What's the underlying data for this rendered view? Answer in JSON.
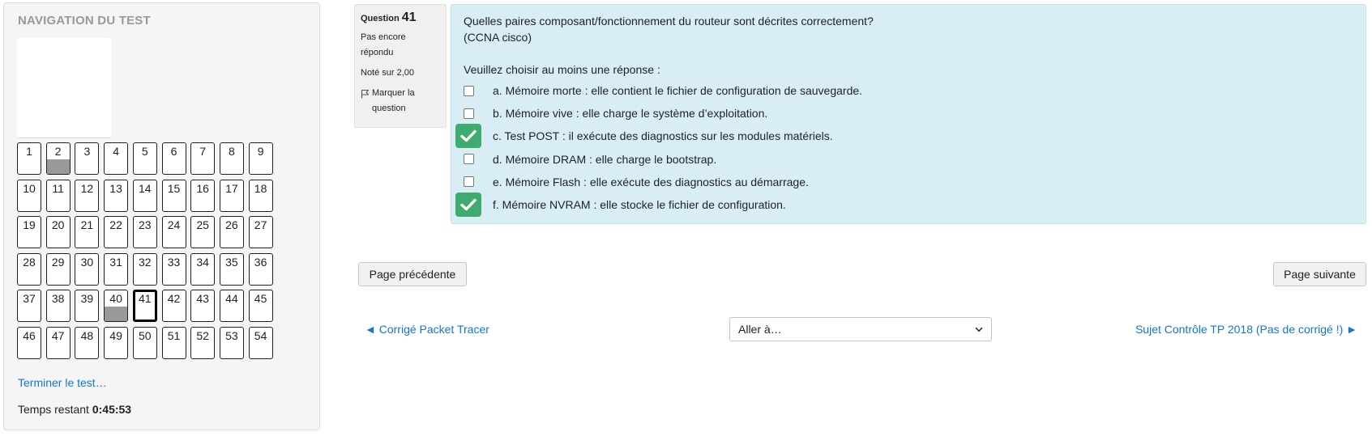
{
  "nav": {
    "title": "NAVIGATION DU TEST",
    "questions": [
      {
        "n": "1",
        "state": "unanswered"
      },
      {
        "n": "2",
        "state": "answered"
      },
      {
        "n": "3",
        "state": "unanswered"
      },
      {
        "n": "4",
        "state": "unanswered"
      },
      {
        "n": "5",
        "state": "unanswered"
      },
      {
        "n": "6",
        "state": "unanswered"
      },
      {
        "n": "7",
        "state": "unanswered"
      },
      {
        "n": "8",
        "state": "unanswered"
      },
      {
        "n": "9",
        "state": "unanswered"
      },
      {
        "n": "10",
        "state": "unanswered"
      },
      {
        "n": "11",
        "state": "unanswered"
      },
      {
        "n": "12",
        "state": "unanswered"
      },
      {
        "n": "13",
        "state": "unanswered"
      },
      {
        "n": "14",
        "state": "unanswered"
      },
      {
        "n": "15",
        "state": "unanswered"
      },
      {
        "n": "16",
        "state": "unanswered"
      },
      {
        "n": "17",
        "state": "unanswered"
      },
      {
        "n": "18",
        "state": "unanswered"
      },
      {
        "n": "19",
        "state": "unanswered"
      },
      {
        "n": "20",
        "state": "unanswered"
      },
      {
        "n": "21",
        "state": "unanswered"
      },
      {
        "n": "22",
        "state": "unanswered"
      },
      {
        "n": "23",
        "state": "unanswered"
      },
      {
        "n": "24",
        "state": "unanswered"
      },
      {
        "n": "25",
        "state": "unanswered"
      },
      {
        "n": "26",
        "state": "unanswered"
      },
      {
        "n": "27",
        "state": "unanswered"
      },
      {
        "n": "28",
        "state": "unanswered"
      },
      {
        "n": "29",
        "state": "unanswered"
      },
      {
        "n": "30",
        "state": "unanswered"
      },
      {
        "n": "31",
        "state": "unanswered"
      },
      {
        "n": "32",
        "state": "unanswered"
      },
      {
        "n": "33",
        "state": "unanswered"
      },
      {
        "n": "34",
        "state": "unanswered"
      },
      {
        "n": "35",
        "state": "unanswered"
      },
      {
        "n": "36",
        "state": "unanswered"
      },
      {
        "n": "37",
        "state": "unanswered"
      },
      {
        "n": "38",
        "state": "unanswered"
      },
      {
        "n": "39",
        "state": "unanswered"
      },
      {
        "n": "40",
        "state": "answered"
      },
      {
        "n": "41",
        "state": "current"
      },
      {
        "n": "42",
        "state": "unanswered"
      },
      {
        "n": "43",
        "state": "unanswered"
      },
      {
        "n": "44",
        "state": "unanswered"
      },
      {
        "n": "45",
        "state": "unanswered"
      },
      {
        "n": "46",
        "state": "unanswered"
      },
      {
        "n": "47",
        "state": "unanswered"
      },
      {
        "n": "48",
        "state": "unanswered"
      },
      {
        "n": "49",
        "state": "unanswered"
      },
      {
        "n": "50",
        "state": "unanswered"
      },
      {
        "n": "51",
        "state": "unanswered"
      },
      {
        "n": "52",
        "state": "unanswered"
      },
      {
        "n": "53",
        "state": "unanswered"
      },
      {
        "n": "54",
        "state": "unanswered"
      }
    ],
    "finish_link": "Terminer le test…",
    "time_label": "Temps restant",
    "time_value": "0:45:53"
  },
  "question_info": {
    "label": "Question",
    "number": "41",
    "state_line1": "Pas encore",
    "state_line2": "répondu",
    "grade": "Noté sur 2,00",
    "flag_line1": "Marquer la",
    "flag_line2": "question",
    "flag_icon": "flag-outline-icon"
  },
  "question": {
    "text_line1": "Quelles paires composant/fonctionnement du routeur sont décrites correctement?",
    "text_line2": "(CCNA cisco)",
    "prompt": "Veuillez choisir au moins une réponse :",
    "answers": [
      {
        "label": "a. Mémoire morte : elle contient le fichier de configuration de sauvegarde.",
        "checked": false
      },
      {
        "label": "b. Mémoire vive : elle charge le système d’exploitation.",
        "checked": false
      },
      {
        "label": "c. Test POST : il exécute des diagnostics sur les modules matériels.",
        "checked": true
      },
      {
        "label": "d. Mémoire DRAM : elle charge le bootstrap.",
        "checked": false
      },
      {
        "label": "e. Mémoire Flash : elle exécute des diagnostics au démarrage.",
        "checked": false
      },
      {
        "label": "f. Mémoire NVRAM : elle stocke le fichier de configuration.",
        "checked": true
      }
    ],
    "checked_color": "#3fab6f"
  },
  "buttons": {
    "prev": "Page précédente",
    "next": "Page suivante"
  },
  "activity_nav": {
    "prev_link": "◄ Corrigé Packet Tracer",
    "jump_selected": "Aller à…",
    "next_link": "Sujet Contrôle TP 2018 (Pas de corrigé !) ►"
  },
  "colors": {
    "link": "#1177d1",
    "question_bg": "#d9edf5",
    "answered_fill": "#999999"
  }
}
